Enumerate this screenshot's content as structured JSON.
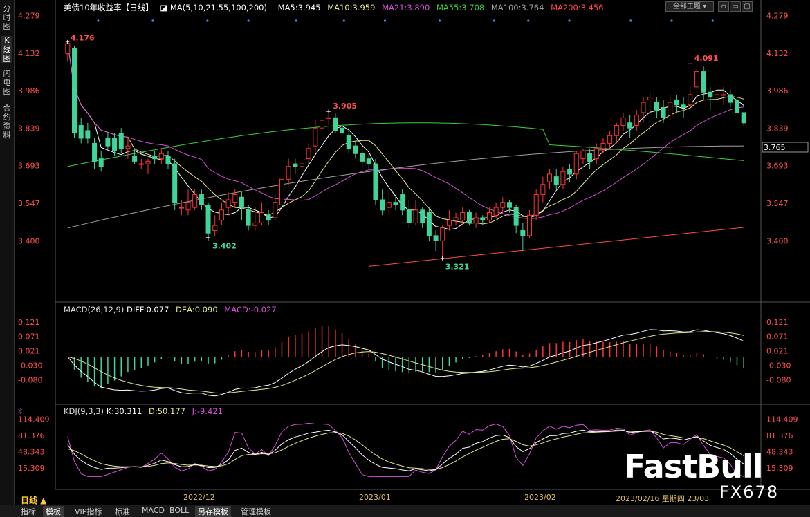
{
  "sidebar": {
    "tabs": [
      {
        "label": "分时图",
        "active": false
      },
      {
        "label": "K线图",
        "active": true
      },
      {
        "label": "闪电图",
        "active": false
      },
      {
        "label": "合约资料",
        "active": false
      }
    ]
  },
  "header": {
    "title": "美债10年收益率",
    "period": "【日线】",
    "ma_label": "MA(5,10,21,55,100,200)",
    "ma5": "MA5:3.945",
    "ma10": "MA10:3.959",
    "ma21": "MA21:3.890",
    "ma55": "MA55:3.708",
    "ma100": "MA100:3.764",
    "ma200": "MA200:3.456",
    "theme_select": "全部主题"
  },
  "macd": {
    "label": "MACD(26,12,9)",
    "diff": "DIFF:0.077",
    "dea": "DEA:0.090",
    "macd": "MACD:-0.027"
  },
  "kdj": {
    "label": "KDJ(9,3,3)",
    "k": "K:30.311",
    "d": "D:50.177",
    "j": "J:-9.421"
  },
  "xaxis": {
    "period_label": "日线 ▲",
    "months": [
      "2022/12",
      "2023/01",
      "2023/02"
    ],
    "cursor_label": "2023/02/16 星期四 23/03"
  },
  "bottom_bar": {
    "buttons": [
      "指标",
      "模板",
      "VIP指标",
      "标准",
      "MACD",
      "BOLL",
      "另存模板",
      "管理模板"
    ]
  },
  "watermark": {
    "line1": "FastBull",
    "line2": "FX678"
  },
  "colors": {
    "up": "#ff3333",
    "down": "#3fd49a",
    "ma5": "#ffffff",
    "ma10": "#e6e68a",
    "ma21": "#d94fd9",
    "ma55": "#3ccf3c",
    "ma100": "#a0a0a0",
    "ma200": "#ff4a4a",
    "axis_text": "#ff5050"
  },
  "chart_data": {
    "type": "candlestick",
    "title": "美债10年收益率",
    "price_axis": {
      "ticks": [
        "4.279",
        "4.132",
        "3.986",
        "3.839",
        "3.693",
        "3.547",
        "3.400"
      ],
      "ylim": [
        3.32,
        4.28
      ],
      "current": "3.765"
    },
    "annotations": {
      "high1": "4.176",
      "high2": "3.905",
      "high3": "4.091",
      "low1": "3.402",
      "low2": "3.321"
    },
    "candles": [
      [
        4.13,
        4.17,
        4.1,
        4.18
      ],
      [
        4.15,
        3.82,
        3.8,
        4.16
      ],
      [
        3.85,
        3.8,
        3.78,
        3.88
      ],
      [
        3.83,
        3.8,
        3.78,
        3.86
      ],
      [
        3.78,
        3.71,
        3.68,
        3.8
      ],
      [
        3.72,
        3.69,
        3.67,
        3.75
      ],
      [
        3.8,
        3.77,
        3.76,
        3.82
      ],
      [
        3.8,
        3.75,
        3.73,
        3.82
      ],
      [
        3.82,
        3.76,
        3.74,
        3.84
      ],
      [
        3.76,
        3.77,
        3.72,
        3.8
      ],
      [
        3.73,
        3.71,
        3.7,
        3.76
      ],
      [
        3.7,
        3.7,
        3.68,
        3.72
      ],
      [
        3.7,
        3.71,
        3.66,
        3.72
      ],
      [
        3.73,
        3.72,
        3.7,
        3.75
      ],
      [
        3.72,
        3.74,
        3.7,
        3.76
      ],
      [
        3.73,
        3.7,
        3.68,
        3.75
      ],
      [
        3.7,
        3.55,
        3.52,
        3.72
      ],
      [
        3.53,
        3.53,
        3.5,
        3.56
      ],
      [
        3.52,
        3.55,
        3.5,
        3.6
      ],
      [
        3.53,
        3.58,
        3.52,
        3.6
      ],
      [
        3.58,
        3.54,
        3.52,
        3.6
      ],
      [
        3.54,
        3.43,
        3.4,
        3.55
      ],
      [
        3.44,
        3.46,
        3.42,
        3.5
      ],
      [
        3.48,
        3.52,
        3.46,
        3.55
      ],
      [
        3.53,
        3.56,
        3.5,
        3.59
      ],
      [
        3.55,
        3.58,
        3.53,
        3.6
      ],
      [
        3.57,
        3.53,
        3.48,
        3.59
      ],
      [
        3.52,
        3.46,
        3.44,
        3.54
      ],
      [
        3.46,
        3.47,
        3.44,
        3.53
      ],
      [
        3.47,
        3.51,
        3.46,
        3.55
      ],
      [
        3.5,
        3.48,
        3.46,
        3.52
      ],
      [
        3.49,
        3.55,
        3.48,
        3.58
      ],
      [
        3.54,
        3.64,
        3.52,
        3.66
      ],
      [
        3.64,
        3.69,
        3.62,
        3.72
      ],
      [
        3.7,
        3.69,
        3.66,
        3.72
      ],
      [
        3.69,
        3.7,
        3.67,
        3.73
      ],
      [
        3.72,
        3.76,
        3.7,
        3.78
      ],
      [
        3.77,
        3.84,
        3.74,
        3.87
      ],
      [
        3.84,
        3.87,
        3.82,
        3.89
      ],
      [
        3.88,
        3.88,
        3.85,
        3.9
      ],
      [
        3.88,
        3.83,
        3.82,
        3.9
      ],
      [
        3.84,
        3.82,
        3.8,
        3.86
      ],
      [
        3.81,
        3.76,
        3.74,
        3.84
      ],
      [
        3.77,
        3.74,
        3.72,
        3.79
      ],
      [
        3.74,
        3.71,
        3.68,
        3.76
      ],
      [
        3.72,
        3.7,
        3.68,
        3.74
      ],
      [
        3.7,
        3.56,
        3.54,
        3.72
      ],
      [
        3.56,
        3.52,
        3.5,
        3.6
      ],
      [
        3.53,
        3.55,
        3.5,
        3.6
      ],
      [
        3.55,
        3.54,
        3.52,
        3.58
      ],
      [
        3.58,
        3.52,
        3.5,
        3.6
      ],
      [
        3.52,
        3.47,
        3.45,
        3.56
      ],
      [
        3.47,
        3.52,
        3.46,
        3.56
      ],
      [
        3.52,
        3.47,
        3.45,
        3.53
      ],
      [
        3.51,
        3.42,
        3.4,
        3.53
      ],
      [
        3.42,
        3.4,
        3.36,
        3.44
      ],
      [
        3.4,
        3.45,
        3.32,
        3.46
      ],
      [
        3.46,
        3.48,
        3.44,
        3.52
      ],
      [
        3.48,
        3.49,
        3.46,
        3.51
      ],
      [
        3.48,
        3.51,
        3.46,
        3.53
      ],
      [
        3.51,
        3.47,
        3.46,
        3.52
      ],
      [
        3.47,
        3.49,
        3.45,
        3.51
      ],
      [
        3.49,
        3.48,
        3.46,
        3.5
      ],
      [
        3.48,
        3.51,
        3.47,
        3.53
      ],
      [
        3.5,
        3.53,
        3.49,
        3.55
      ],
      [
        3.53,
        3.55,
        3.51,
        3.57
      ],
      [
        3.55,
        3.53,
        3.51,
        3.56
      ],
      [
        3.53,
        3.46,
        3.43,
        3.54
      ],
      [
        3.44,
        3.42,
        3.36,
        3.47
      ],
      [
        3.42,
        3.5,
        3.41,
        3.52
      ],
      [
        3.5,
        3.58,
        3.48,
        3.6
      ],
      [
        3.58,
        3.62,
        3.55,
        3.65
      ],
      [
        3.63,
        3.66,
        3.6,
        3.68
      ],
      [
        3.65,
        3.62,
        3.6,
        3.68
      ],
      [
        3.62,
        3.67,
        3.6,
        3.69
      ],
      [
        3.68,
        3.66,
        3.63,
        3.7
      ],
      [
        3.66,
        3.74,
        3.64,
        3.75
      ],
      [
        3.72,
        3.75,
        3.7,
        3.76
      ],
      [
        3.74,
        3.71,
        3.68,
        3.76
      ],
      [
        3.72,
        3.76,
        3.7,
        3.78
      ],
      [
        3.76,
        3.78,
        3.74,
        3.8
      ],
      [
        3.78,
        3.81,
        3.76,
        3.83
      ],
      [
        3.81,
        3.85,
        3.78,
        3.86
      ],
      [
        3.85,
        3.88,
        3.83,
        3.9
      ],
      [
        3.86,
        3.84,
        3.8,
        3.89
      ],
      [
        3.85,
        3.89,
        3.83,
        3.91
      ],
      [
        3.9,
        3.94,
        3.86,
        3.96
      ],
      [
        3.95,
        3.96,
        3.9,
        3.98
      ],
      [
        3.94,
        3.91,
        3.88,
        3.96
      ],
      [
        3.92,
        3.88,
        3.86,
        3.95
      ],
      [
        3.89,
        3.94,
        3.87,
        3.97
      ],
      [
        3.95,
        3.93,
        3.9,
        3.97
      ],
      [
        3.93,
        3.92,
        3.88,
        3.96
      ],
      [
        3.93,
        3.97,
        3.92,
        4.0
      ],
      [
        4.0,
        4.06,
        3.98,
        4.09
      ],
      [
        4.06,
        3.98,
        3.95,
        4.08
      ],
      [
        3.98,
        3.96,
        3.91,
        4.0
      ],
      [
        3.96,
        3.97,
        3.93,
        4.0
      ],
      [
        3.97,
        3.97,
        3.93,
        4.0
      ],
      [
        3.97,
        3.94,
        3.92,
        3.99
      ],
      [
        3.95,
        3.9,
        3.88,
        4.02
      ],
      [
        3.9,
        3.86,
        3.85,
        3.9
      ]
    ]
  }
}
